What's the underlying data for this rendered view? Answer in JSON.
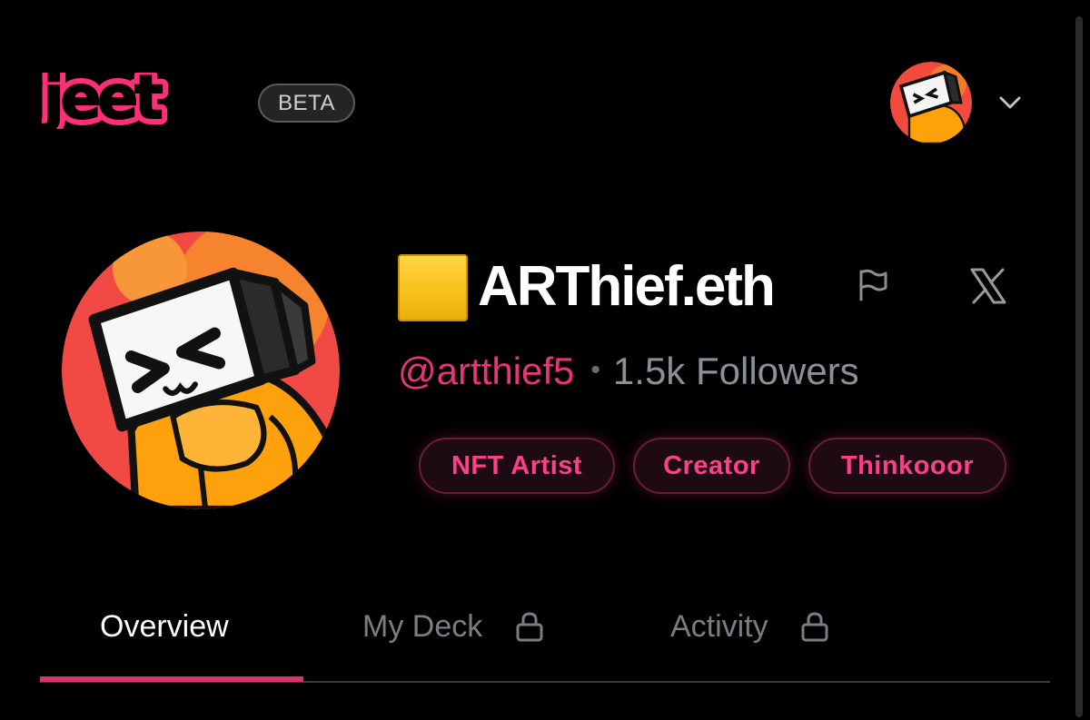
{
  "header": {
    "logo_text": "jeet",
    "badge": "BETA"
  },
  "profile": {
    "emoji": "🟨",
    "name": "ARThief.eth",
    "handle": "@artthief5",
    "separator": "•",
    "followers": "1.5k Followers",
    "tags": [
      "NFT Artist",
      "Creator",
      "Thinkooor"
    ]
  },
  "tabs": [
    {
      "label": "Overview",
      "active": true,
      "locked": false
    },
    {
      "label": "My Deck",
      "active": false,
      "locked": true
    },
    {
      "label": "Activity",
      "active": false,
      "locked": true
    }
  ],
  "icons": {
    "flag": "flag-icon",
    "x": "x-logo-icon",
    "chevron": "chevron-down-icon",
    "lock": "lock-icon"
  },
  "colors": {
    "accent": "#e8357a",
    "background": "#000000",
    "muted": "#7a7d84",
    "name_square": "#f7c21c"
  }
}
